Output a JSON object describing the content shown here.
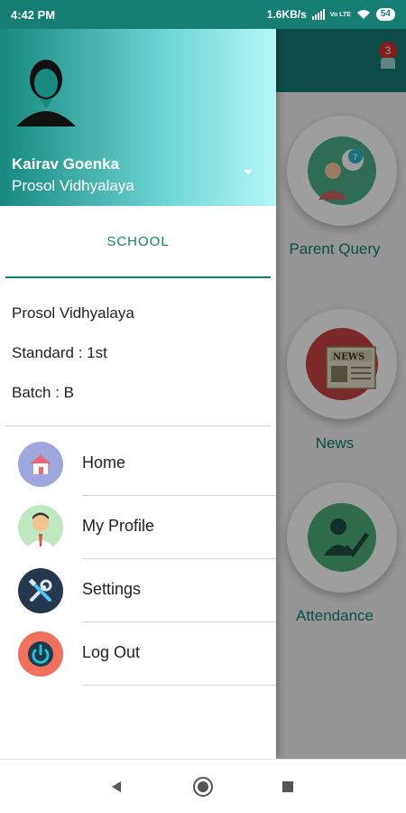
{
  "status_bar": {
    "time": "4:42 PM",
    "speed": "1.6KB/s",
    "network": "Vo LTE",
    "battery": "54",
    "icons": [
      "signal-icon",
      "wifi-icon",
      "battery-icon"
    ]
  },
  "main": {
    "notification_count": "3",
    "tiles": [
      {
        "label": "Parent Query",
        "icon": "parent-query-icon"
      },
      {
        "label": "News",
        "icon": "news-icon"
      },
      {
        "label": "Attendance",
        "icon": "attendance-icon"
      }
    ]
  },
  "drawer": {
    "user_name": "Kairav Goenka",
    "user_school": "Prosol Vidhyalaya",
    "tab": "SCHOOL",
    "school_name": "Prosol Vidhyalaya",
    "standard": "Standard : 1st",
    "batch": "Batch : B",
    "menu": [
      {
        "label": "Home",
        "icon": "home-icon"
      },
      {
        "label": "My Profile",
        "icon": "profile-icon"
      },
      {
        "label": "Settings",
        "icon": "settings-icon"
      },
      {
        "label": "Log Out",
        "icon": "power-icon"
      }
    ]
  },
  "nav": {
    "buttons": [
      "back-icon",
      "home-circle-icon",
      "recents-icon"
    ]
  },
  "colors": {
    "primary": "#167d73",
    "badge": "#d32f2f"
  }
}
